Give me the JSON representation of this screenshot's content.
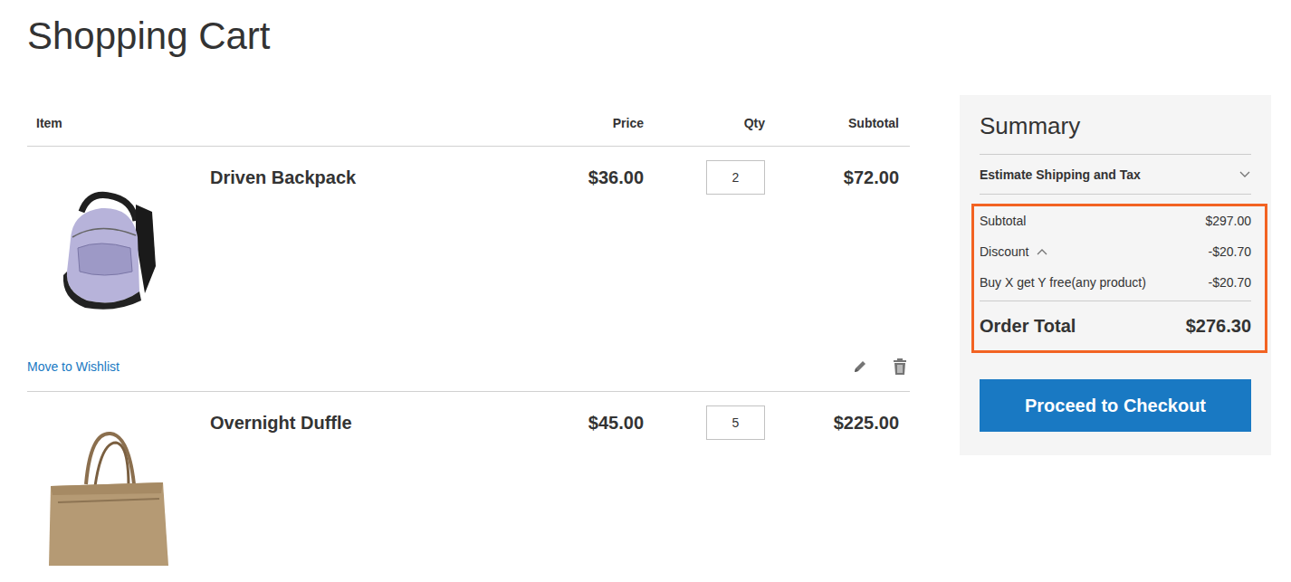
{
  "title": "Shopping Cart",
  "table": {
    "columns": [
      "Item",
      "Price",
      "Qty",
      "Subtotal"
    ],
    "rows": [
      {
        "name": "Driven Backpack",
        "price": "$36.00",
        "qty": "2",
        "subtotal": "$72.00",
        "wishlist": "Move to Wishlist"
      },
      {
        "name": "Overnight Duffle",
        "price": "$45.00",
        "qty": "5",
        "subtotal": "$225.00"
      }
    ]
  },
  "summary": {
    "title": "Summary",
    "shipping": {
      "label": "Estimate Shipping and Tax",
      "expanded": false
    },
    "subtotal": {
      "label": "Subtotal",
      "amount": "$297.00"
    },
    "discount": {
      "label": "Discount",
      "amount": "-$20.70",
      "expanded": true,
      "items": [
        {
          "label": "Buy X get Y free(any product)",
          "amount": "-$20.70"
        }
      ]
    },
    "order_total": {
      "label": "Order Total",
      "amount": "$276.30"
    },
    "checkout": "Proceed to Checkout"
  }
}
